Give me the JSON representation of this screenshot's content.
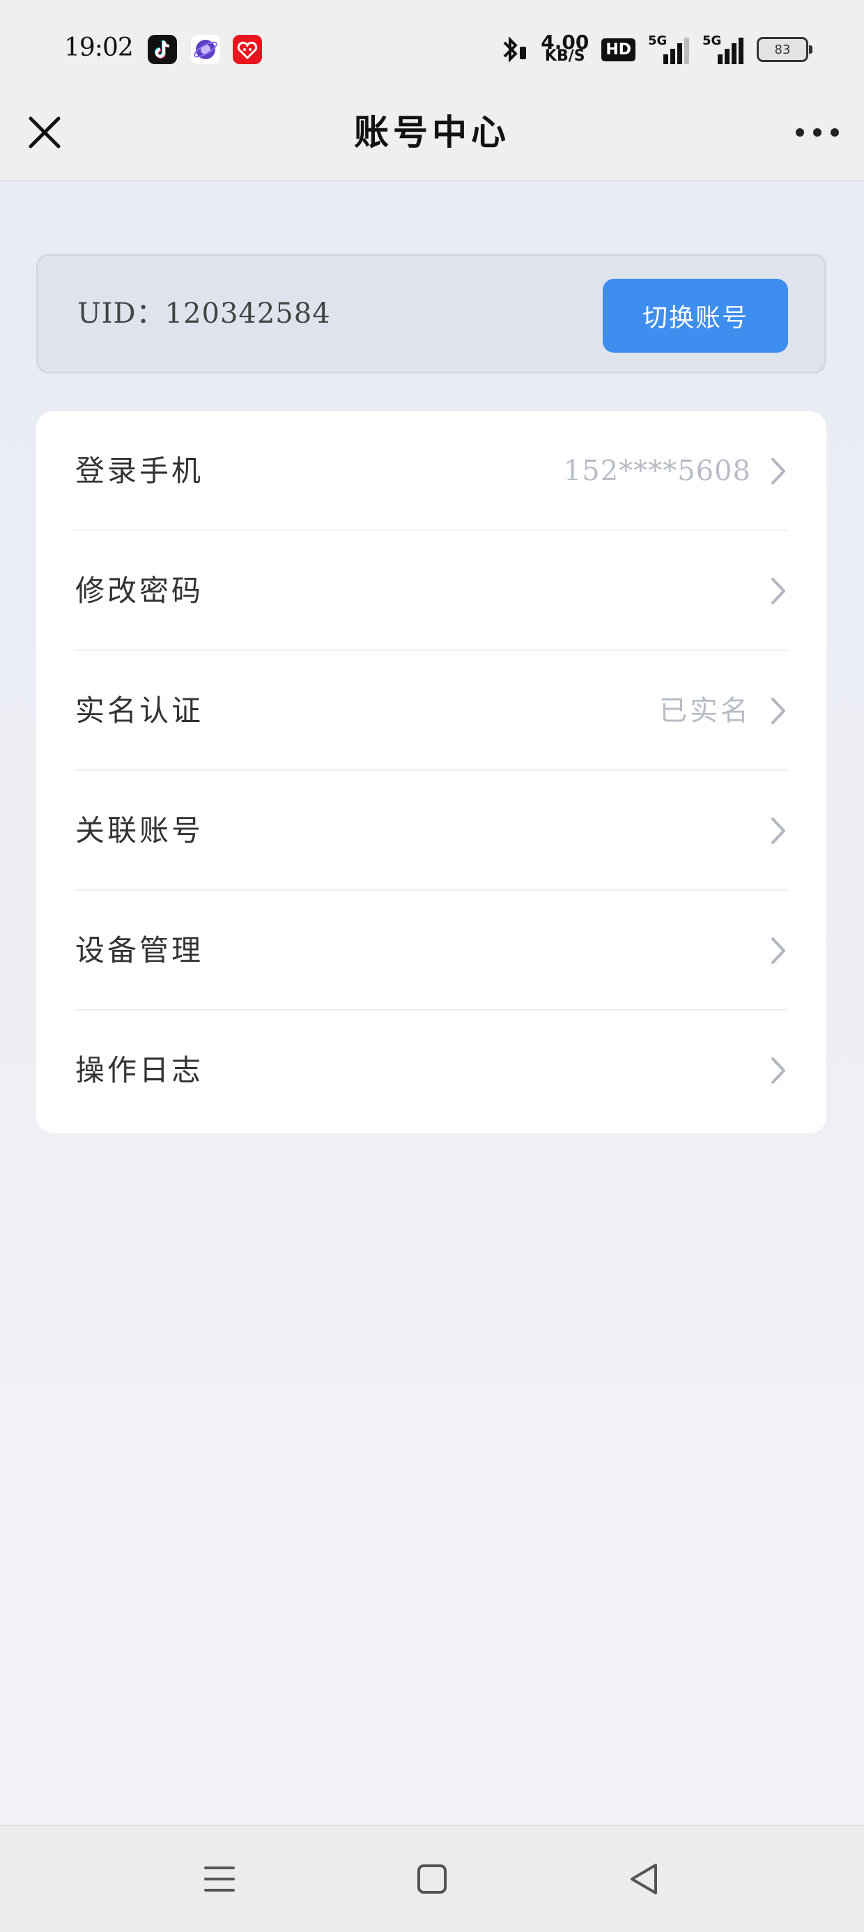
{
  "status_bar": {
    "time": "19:02",
    "net_speed_value": "4.00",
    "net_speed_unit": "KB/S",
    "hd_label": "HD",
    "signal1_label": "5G",
    "signal2_label": "5G",
    "battery_level": "83"
  },
  "nav": {
    "title": "账号中心"
  },
  "account": {
    "uid_label": "UID：",
    "uid_value": "120342584",
    "switch_label": "切换账号"
  },
  "menu": {
    "items": [
      {
        "label": "登录手机",
        "value": "152****5608"
      },
      {
        "label": "修改密码",
        "value": ""
      },
      {
        "label": "实名认证",
        "value": "已实名"
      },
      {
        "label": "关联账号",
        "value": ""
      },
      {
        "label": "设备管理",
        "value": ""
      },
      {
        "label": "操作日志",
        "value": ""
      }
    ]
  },
  "colors": {
    "accent": "#3e8ef0",
    "muted_text": "#b7bcc6",
    "label_text": "#333333"
  }
}
